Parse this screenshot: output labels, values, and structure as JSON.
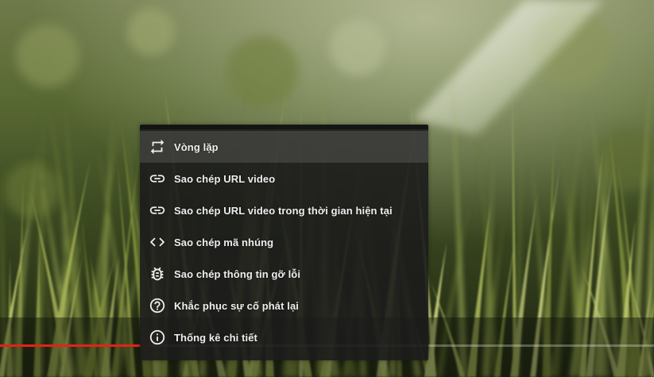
{
  "player": {
    "progress_fraction": 0.23,
    "colors": {
      "progress_played": "#e62117",
      "menu_text": "#eeeeee",
      "menu_background": "#1c1c1c"
    }
  },
  "context_menu": {
    "items": [
      {
        "label": "Vòng lặp",
        "icon": "loop-icon"
      },
      {
        "label": "Sao chép URL video",
        "icon": "link-icon"
      },
      {
        "label": "Sao chép URL video trong thời gian hiện tại",
        "icon": "link-icon"
      },
      {
        "label": "Sao chép mã nhúng",
        "icon": "code-icon"
      },
      {
        "label": "Sao chép thông tin gỡ lỗi",
        "icon": "bug-icon"
      },
      {
        "label": "Khắc phục sự cố phát lại",
        "icon": "help-icon"
      },
      {
        "label": "Thống kê chi tiết",
        "icon": "info-icon"
      }
    ]
  }
}
